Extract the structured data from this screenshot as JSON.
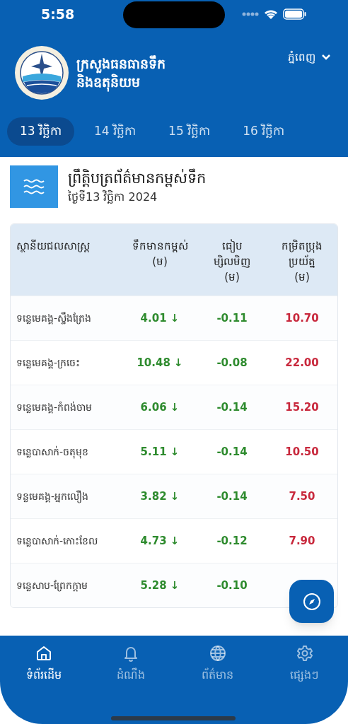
{
  "status_bar": {
    "time": "5:58"
  },
  "header": {
    "title_lines": [
      "ក្រសួងធនធានទឹក",
      "និងឧតុនិយម"
    ],
    "location": "ភ្នំពេញ"
  },
  "date_tabs": [
    {
      "label": "13 វិច្ឆិកា",
      "selected": true
    },
    {
      "label": "14 វិច្ឆិកា",
      "selected": false
    },
    {
      "label": "15 វិច្ឆិកា",
      "selected": false
    },
    {
      "label": "16 វិច្ឆិកា",
      "selected": false
    }
  ],
  "bulletin": {
    "title": "ព្រឹត្តិបត្រព័ត៌មានកម្ពស់ទឹក",
    "date": "ថ្ងៃទី13 វិច្ឆិកា 2024"
  },
  "table": {
    "columns": [
      {
        "lines": [
          "ស្ថានីយជលសាស្ត្រ"
        ]
      },
      {
        "lines": [
          "ទឹកមានកម្ពស់",
          "(ម)"
        ]
      },
      {
        "lines": [
          "ធៀប",
          "ម្សិលមិញ",
          "(ម)"
        ]
      },
      {
        "lines": [
          "កម្រិតប្រុង",
          "ប្រយ័ត្ន",
          "(ម)"
        ]
      }
    ],
    "rows": [
      {
        "station": "ទន្លេមេគង្គ-ស្ទឹងត្រែង",
        "level": "4.01",
        "trend": "↓",
        "change": "-0.11",
        "warning": "10.70"
      },
      {
        "station": "ទន្លេមេគង្គ-ក្រចេះ",
        "level": "10.48",
        "trend": "↓",
        "change": "-0.08",
        "warning": "22.00"
      },
      {
        "station": "ទន្លេមេគង្គ-កំពង់ចាម",
        "level": "6.06",
        "trend": "↓",
        "change": "-0.14",
        "warning": "15.20"
      },
      {
        "station": "ទន្លេបាសាក់-ចតុមុខ",
        "level": "5.11",
        "trend": "↓",
        "change": "-0.14",
        "warning": "10.50"
      },
      {
        "station": "ទន្លមេគង្គ-អ្នកលឿង",
        "level": "3.82",
        "trend": "↓",
        "change": "-0.14",
        "warning": "7.50"
      },
      {
        "station": "ទន្លេបាសាក់-កោះខែល",
        "level": "4.73",
        "trend": "↓",
        "change": "-0.12",
        "warning": "7.90"
      },
      {
        "station": "ទន្លេសាប-ព្រែកក្តាម",
        "level": "5.28",
        "trend": "↓",
        "change": "-0.10"
      }
    ]
  },
  "bottom_nav": [
    {
      "label": "ទំព័រដើម",
      "selected": true
    },
    {
      "label": "ដំណឹង",
      "selected": false
    },
    {
      "label": "ព័ត៌មាន",
      "selected": false
    },
    {
      "label": "ផ្សេងៗ",
      "selected": false
    }
  ]
}
